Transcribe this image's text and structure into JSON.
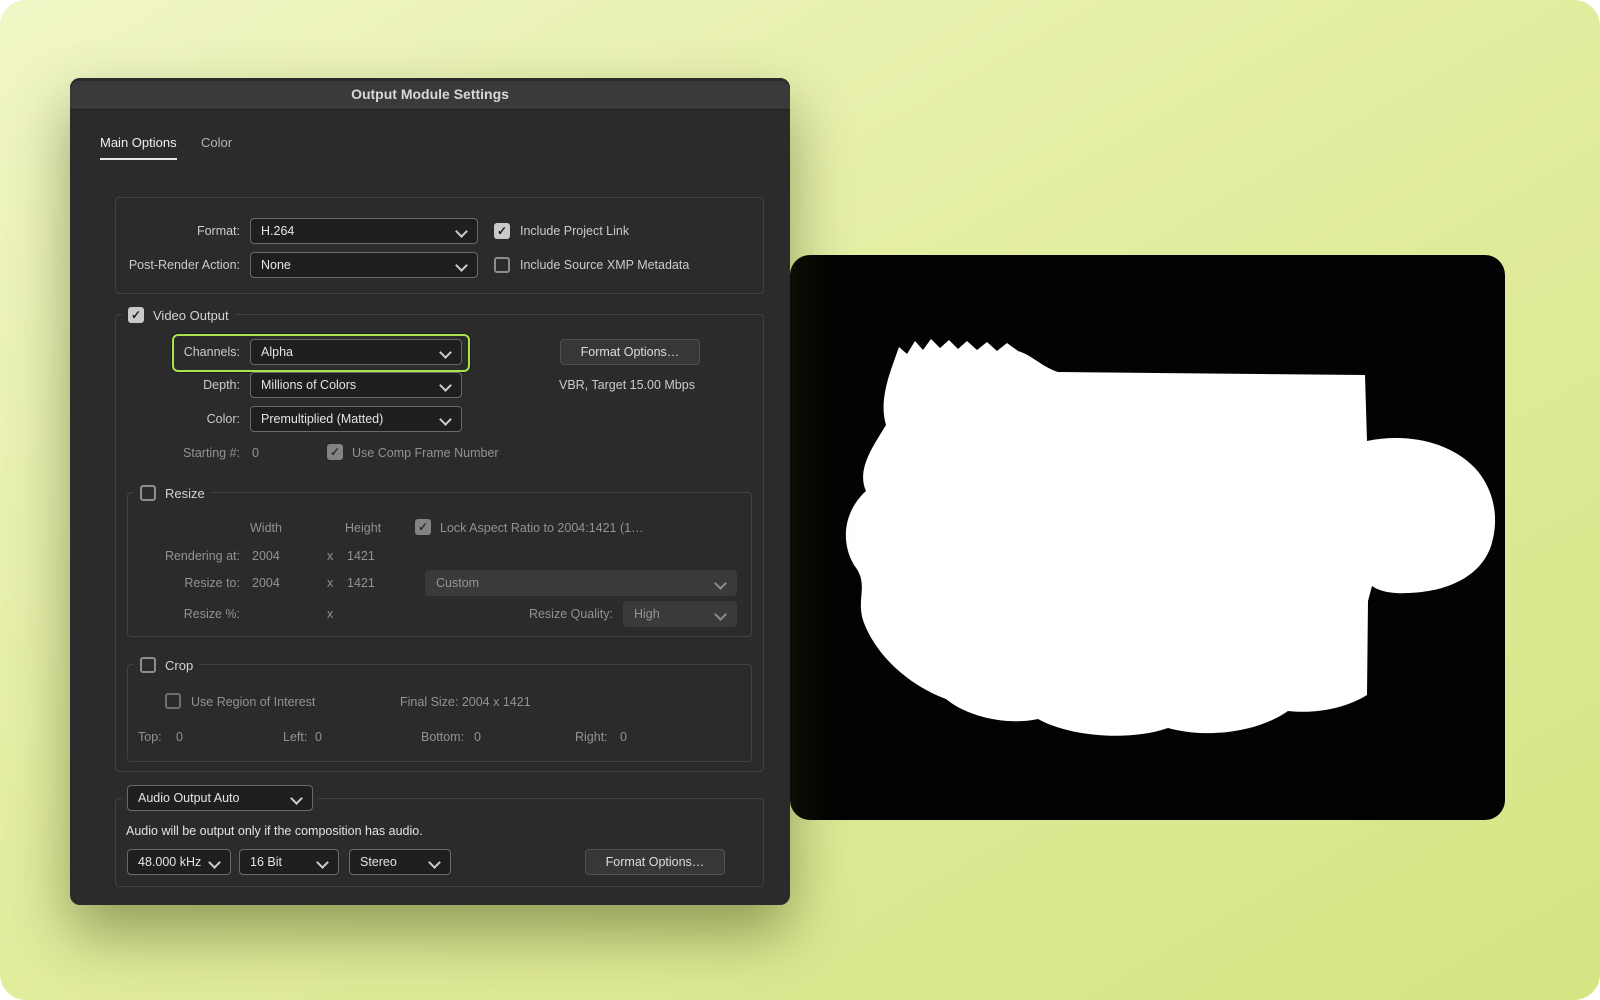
{
  "titlebar": {
    "title": "Output Module Settings"
  },
  "tabs": {
    "main": "Main Options",
    "color": "Color"
  },
  "format_section": {
    "format_label": "Format:",
    "format_value": "H.264",
    "include_project_link_label": "Include Project Link",
    "post_render_label": "Post-Render Action:",
    "post_render_value": "None",
    "xmp_label": "Include Source XMP Metadata"
  },
  "video_output": {
    "legend": "Video Output",
    "channels_label": "Channels:",
    "channels_value": "Alpha",
    "format_options_label": "Format Options…",
    "depth_label": "Depth:",
    "depth_value": "Millions of Colors",
    "bitrate_text": "VBR, Target 15.00 Mbps",
    "color_label": "Color:",
    "color_value": "Premultiplied (Matted)",
    "starting_label": "Starting #:",
    "starting_value": "0",
    "use_comp_frame_label": "Use Comp Frame Number"
  },
  "resize": {
    "legend": "Resize",
    "width_header": "Width",
    "height_header": "Height",
    "lock_aspect_label": "Lock Aspect Ratio to 2004:1421 (1…",
    "rendering_at_label": "Rendering at:",
    "rendering_width": "2004",
    "rendering_height": "1421",
    "x_sep": "x",
    "resize_to_label": "Resize to:",
    "resize_to_width": "2004",
    "resize_to_height": "1421",
    "preset_value": "Custom",
    "percent_label": "Resize %:",
    "quality_label": "Resize Quality:",
    "quality_value": "High"
  },
  "crop": {
    "legend": "Crop",
    "roi_label": "Use Region of Interest",
    "final_size_text": "Final Size: 2004 x 1421",
    "top_label": "Top:",
    "top_value": "0",
    "left_label": "Left:",
    "left_value": "0",
    "bottom_label": "Bottom:",
    "bottom_value": "0",
    "right_label": "Right:",
    "right_value": "0"
  },
  "audio": {
    "mode_value": "Audio Output Auto",
    "note": "Audio will be output only if the composition has audio.",
    "rate_value": "48.000 kHz",
    "depth_value": "16 Bit",
    "channels_value": "Stereo",
    "format_options_label": "Format Options…"
  },
  "icons": {
    "check": "✓"
  },
  "colors": {
    "highlight_green": "#a9e34d",
    "dialog_bg": "#2b2b2b",
    "preview_bg": "#000000",
    "preview_shape": "#ffffff"
  }
}
